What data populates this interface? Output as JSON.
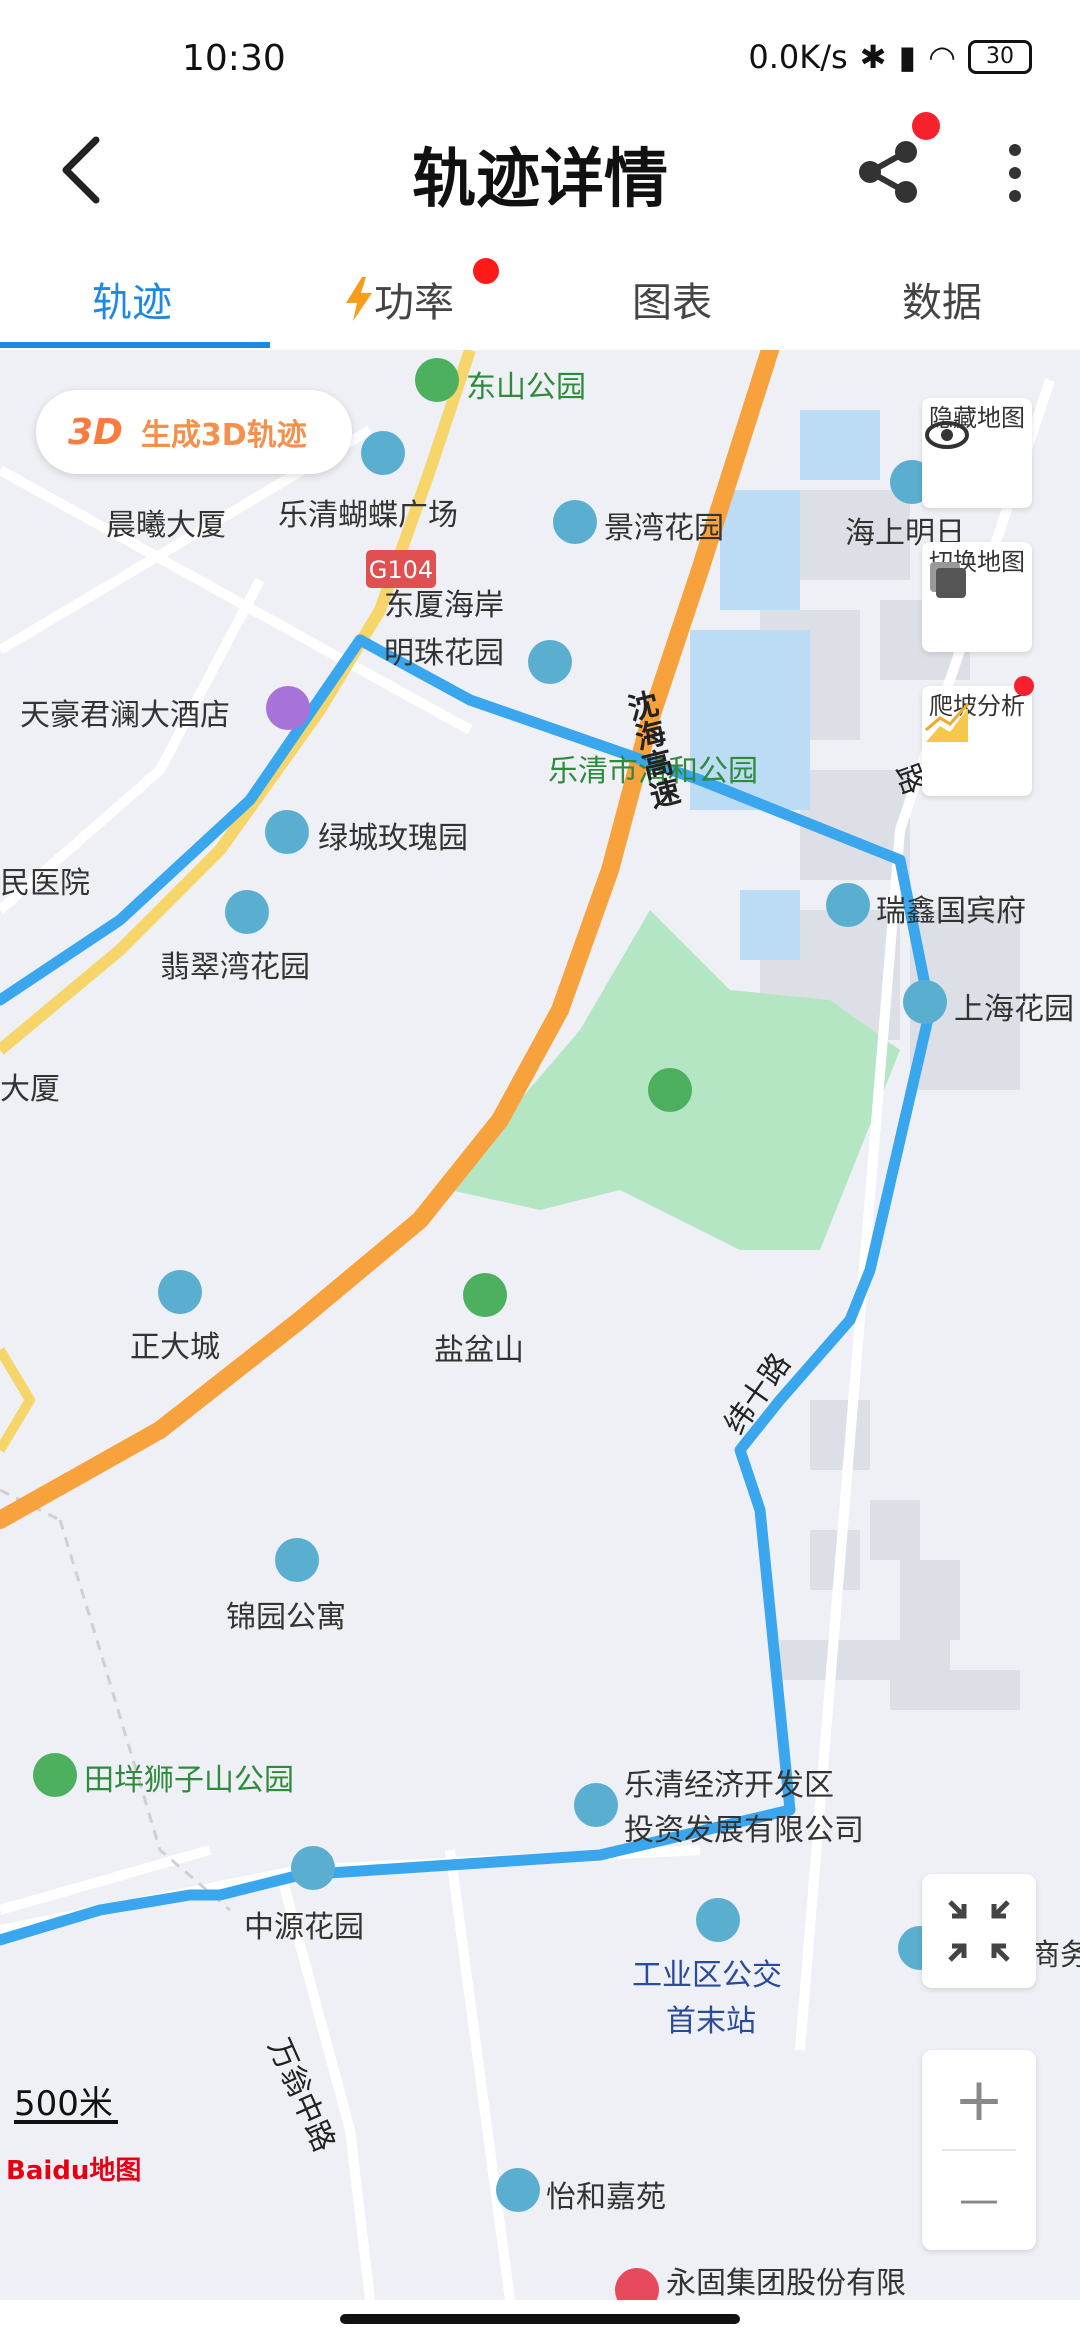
{
  "status_bar": {
    "time": "10:30",
    "network_speed": "0.0K/s",
    "battery": "30"
  },
  "header": {
    "title": "轨迹详情"
  },
  "tabs": [
    {
      "label": "轨迹",
      "active": true
    },
    {
      "label": "功率"
    },
    {
      "label": "图表"
    },
    {
      "label": "数据"
    }
  ],
  "map": {
    "generate_3d": {
      "icon_text": "3D",
      "label": "生成3D轨迹"
    },
    "side_buttons": [
      {
        "label": "隐藏地图",
        "icon": "eye-icon"
      },
      {
        "label": "切换地图",
        "icon": "layers-icon"
      },
      {
        "label": "爬坡分析",
        "icon": "climb-chart-icon"
      }
    ],
    "zoom": {
      "plus": "+",
      "minus": "—"
    },
    "scale": "500米",
    "logo": "Baidu地图",
    "highway_shield": "G104",
    "labels": {
      "dongshan_park": "东山公园",
      "chenxi": "晨曦大厦",
      "butterfly": "乐清蝴蝶广场",
      "jingwan": "景湾花园",
      "haishang": "海上明日",
      "dongxia1": "东厦海岸",
      "dongxia2": "明珠花园",
      "tianhao": "天豪君澜大酒店",
      "lvcheng": "绿城玫瑰园",
      "hospital": "民医院",
      "feicui": "翡翠湾花园",
      "daxia": "大厦",
      "ruixin": "瑞鑫国宾府",
      "shanghai": "上海花园",
      "qinghe": "乐清市清和公园",
      "zhengda": "正大城",
      "yanpen": "盐盆山",
      "jinyuan": "锦园公寓",
      "tianyang": "田垟狮子山公园",
      "kaifa1": "乐清经济开发区",
      "kaifa2": "投资发展有限公司",
      "zhongyuan": "中源花园",
      "bus1": "工业区公交",
      "bus2": "首末站",
      "shangwu": "商务",
      "wanweng": "万翁中路",
      "yihe": "怡和嘉苑",
      "yonggu": "永固集团股份有限",
      "shenhai": "沈海高速",
      "weishi": "纬十路",
      "road_r": "路"
    }
  },
  "colors": {
    "accent": "#1e88e5",
    "track": "#3aa6ee",
    "highway": "#f7a23c",
    "park": "#b5e6c4"
  }
}
